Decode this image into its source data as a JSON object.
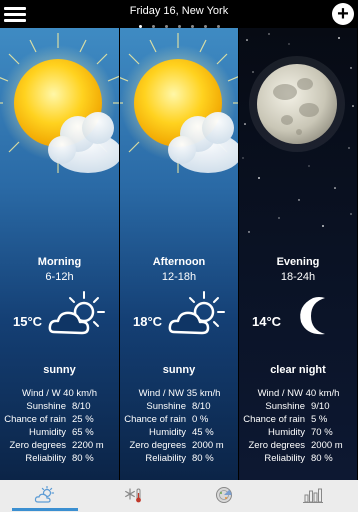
{
  "header": {
    "title": "Friday 16, New York",
    "dots": 7,
    "active_dot": 0
  },
  "panels": [
    {
      "period": "Morning",
      "hours": "6-12h",
      "temp": "15°C",
      "icon": "sun-cloud-icon",
      "condition": "sunny",
      "wind": "Wind / W 40 km/h",
      "rows": [
        {
          "label": "Sunshine",
          "value": "8/10"
        },
        {
          "label": "Chance of rain",
          "value": "25 %"
        },
        {
          "label": "Humidity",
          "value": "65 %"
        },
        {
          "label": "Zero degrees",
          "value": "2200 m"
        },
        {
          "label": "Reliability",
          "value": "80 %"
        }
      ]
    },
    {
      "period": "Afternoon",
      "hours": "12-18h",
      "temp": "18°C",
      "icon": "sun-cloud-icon",
      "condition": "sunny",
      "wind": "Wind / NW 35 km/h",
      "rows": [
        {
          "label": "Sunshine",
          "value": "8/10"
        },
        {
          "label": "Chance of rain",
          "value": "0 %"
        },
        {
          "label": "Humidity",
          "value": "45 %"
        },
        {
          "label": "Zero degrees",
          "value": "2000 m"
        },
        {
          "label": "Reliability",
          "value": "80 %"
        }
      ]
    },
    {
      "period": "Evening",
      "hours": "18-24h",
      "temp": "14°C",
      "icon": "moon-icon",
      "condition": "clear night",
      "wind": "Wind / NW 40 km/h",
      "rows": [
        {
          "label": "Sunshine",
          "value": "9/10"
        },
        {
          "label": "Chance of rain",
          "value": "5 %"
        },
        {
          "label": "Humidity",
          "value": "70 %"
        },
        {
          "label": "Zero degrees",
          "value": "2000 m"
        },
        {
          "label": "Reliability",
          "value": "80 %"
        }
      ]
    }
  ],
  "tabs": [
    {
      "icon": "sun-cloud-tab-icon",
      "active": true
    },
    {
      "icon": "snowflake-thermometer-icon",
      "active": false
    },
    {
      "icon": "radar-icon",
      "active": false
    },
    {
      "icon": "bar-chart-icon",
      "active": false
    }
  ],
  "colors": {
    "sky_top": "#3f8bc3",
    "sky_bottom": "#0b2447",
    "night": "#0a1224",
    "tab_accent": "#3b8fd1",
    "sun": "#f5c21b"
  }
}
